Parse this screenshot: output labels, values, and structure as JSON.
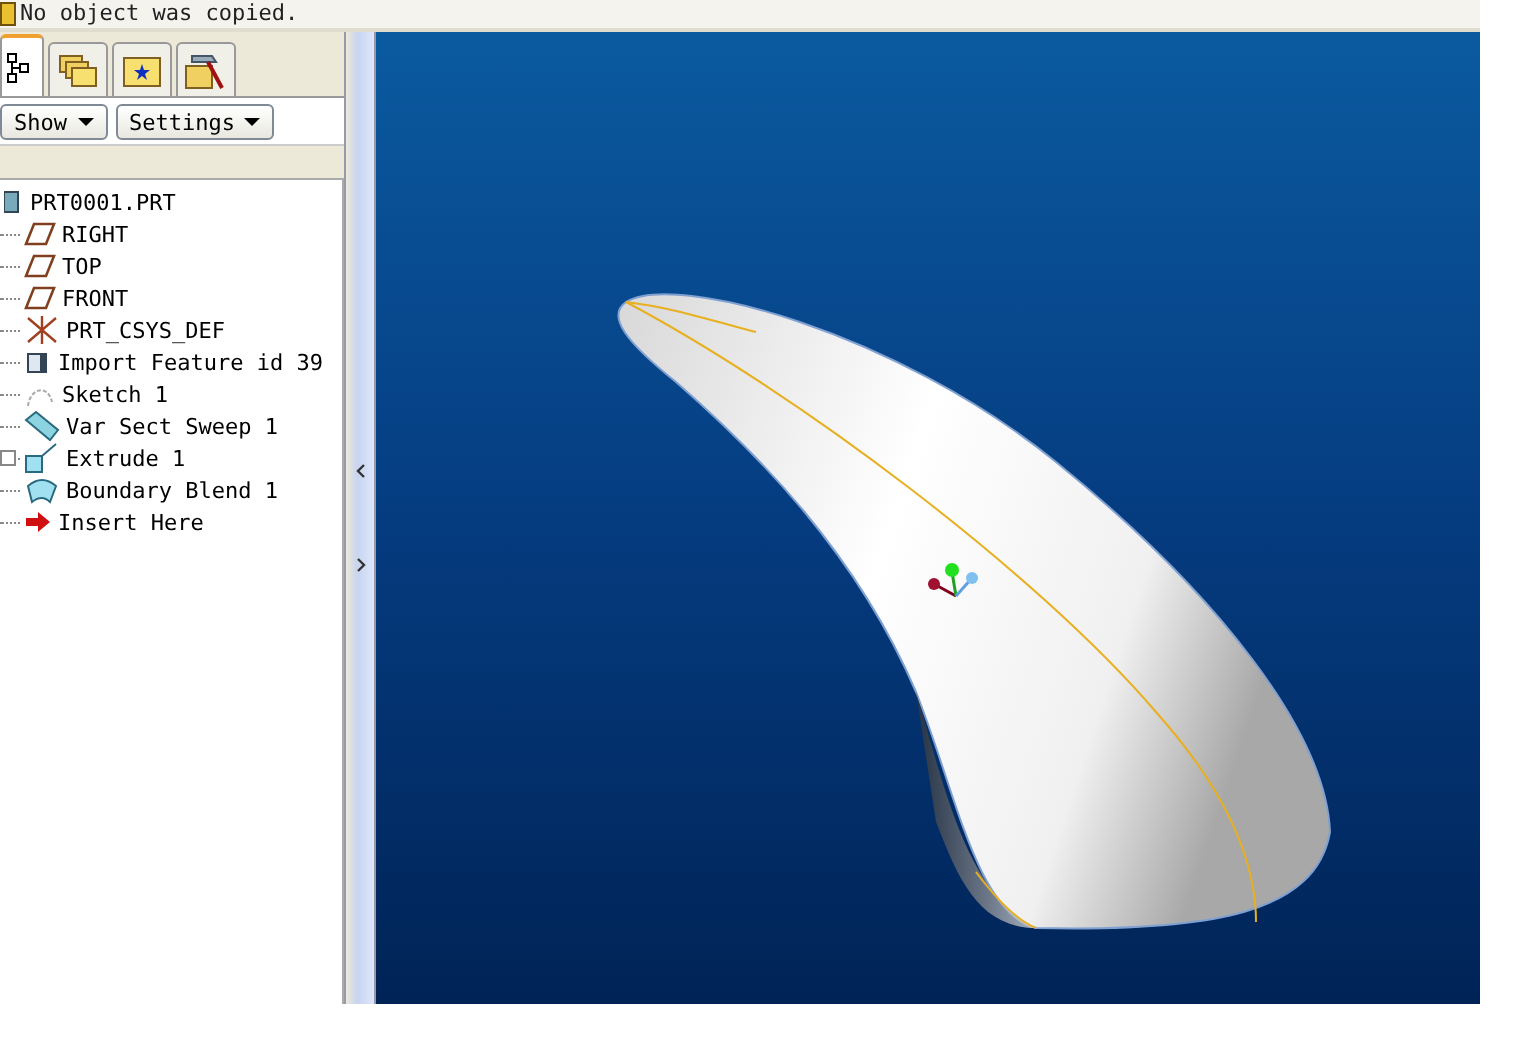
{
  "message_bar": {
    "text": "No object was copied."
  },
  "tabs": [
    {
      "kind": "tree",
      "selected": true
    },
    {
      "kind": "layers",
      "selected": false
    },
    {
      "kind": "favorites",
      "selected": false
    },
    {
      "kind": "tools",
      "selected": false
    }
  ],
  "toolbar": {
    "buttons": [
      {
        "label": "Show"
      },
      {
        "label": "Settings"
      }
    ]
  },
  "model_tree": {
    "root": {
      "label": "PRT0001.PRT",
      "kind": "part"
    },
    "items": [
      {
        "label": "RIGHT",
        "kind": "plane",
        "expandable": false
      },
      {
        "label": "TOP",
        "kind": "plane",
        "expandable": false
      },
      {
        "label": "FRONT",
        "kind": "plane",
        "expandable": false
      },
      {
        "label": "PRT_CSYS_DEF",
        "kind": "csys",
        "expandable": false
      },
      {
        "label": "Import Feature id 39",
        "kind": "import",
        "expandable": false
      },
      {
        "label": "Sketch 1",
        "kind": "sketch",
        "expandable": false
      },
      {
        "label": "Var Sect Sweep 1",
        "kind": "sweep",
        "expandable": false
      },
      {
        "label": "Extrude 1",
        "kind": "extrude",
        "expandable": true
      },
      {
        "label": "Boundary Blend 1",
        "kind": "blend",
        "expandable": false
      },
      {
        "label": "Insert Here",
        "kind": "insert",
        "expandable": false
      }
    ]
  }
}
